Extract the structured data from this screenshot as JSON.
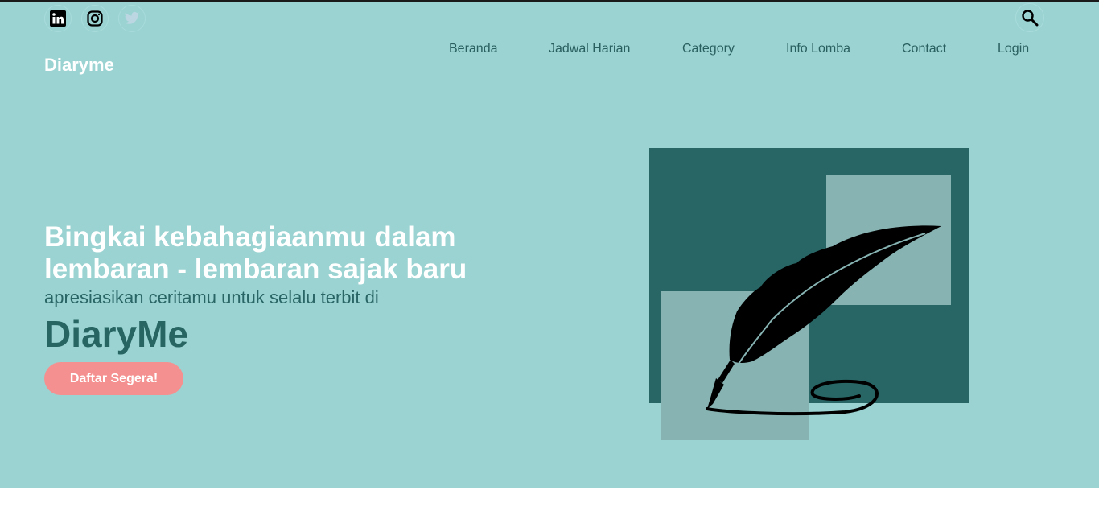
{
  "social": {
    "linkedin_icon": "linkedin-icon",
    "instagram_icon": "instagram-icon",
    "twitter_icon": "twitter-icon"
  },
  "brand": "Diaryme",
  "nav": {
    "items": [
      "Beranda",
      "Jadwal Harian",
      "Category",
      "Info Lomba",
      "Contact",
      "Login"
    ]
  },
  "search": {
    "icon": "search-icon"
  },
  "hero": {
    "headline": "Bingkai kebahagiaanmu dalam lembaran - lembaran sajak baru",
    "subline": "apresiasikan ceritamu untuk selalu terbit di",
    "name": "DiaryMe",
    "cta": "Daftar Segera!"
  },
  "colors": {
    "background": "#9ad3d2",
    "dark_teal": "#286565",
    "light_square": "#87b3b3",
    "accent_pink": "#f49190",
    "nav_text": "#2a5f5f"
  }
}
